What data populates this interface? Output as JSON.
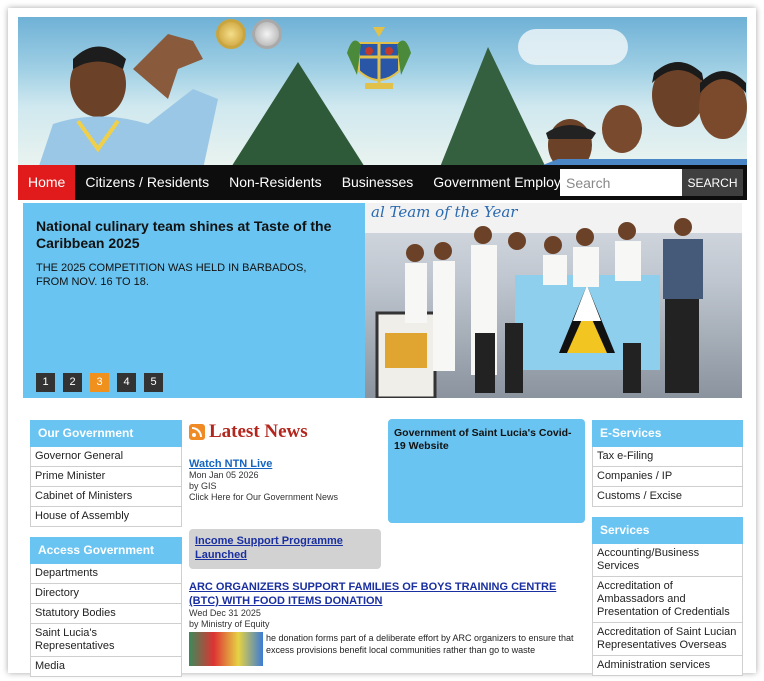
{
  "nav": {
    "items": [
      "Home",
      "Citizens / Residents",
      "Non-Residents",
      "Businesses",
      "Government Employees"
    ],
    "search_placeholder": "Search",
    "search_button": "SEARCH"
  },
  "slider": {
    "headline": "National culinary team shines at Taste of the Caribbean 2025",
    "sub": "THE 2025 COMPETITION WAS HELD IN BARBADOS, FROM NOV. 16 TO 18.",
    "pages": [
      "1",
      "2",
      "3",
      "4",
      "5"
    ],
    "active_page": "3",
    "photo_banner_text": "al Team of the Year"
  },
  "our_government": {
    "title": "Our Government",
    "items": [
      "Governor General",
      "Prime Minister",
      "Cabinet of Ministers",
      "House of Assembly"
    ]
  },
  "access_government": {
    "title": "Access Government",
    "items": [
      "Departments",
      "Directory",
      "Statutory Bodies",
      "Saint Lucia's Representatives",
      "Media"
    ]
  },
  "latest_news": {
    "title": "Latest News",
    "item1": {
      "link": "Watch NTN Live",
      "date": "Mon Jan 05 2026",
      "by": "by GIS",
      "desc": "Click Here for Our Government News"
    },
    "callout_link": "Income Support Programme Launched",
    "item2": {
      "headline": "ARC ORGANIZERS SUPPORT FAMILIES OF BOYS TRAINING CENTRE (BTC) WITH FOOD ITEMS DONATION",
      "date": "Wed Dec 31 2025",
      "by": "by Ministry of Equity",
      "excerpt": "he donation forms part of a deliberate effort by ARC organizers to ensure that excess provisions benefit local communities rather than go to waste"
    }
  },
  "covid": {
    "title": "Government of Saint Lucia's Covid-19 Website"
  },
  "eservices": {
    "title": "E-Services",
    "items": [
      "Tax e-Filing",
      "Companies / IP",
      "Customs / Excise"
    ]
  },
  "services": {
    "title": "Services",
    "items": [
      "Accounting/Business Services",
      "Accreditation of Ambassadors and Presentation of Credentials",
      "Accreditation of Saint Lucian Representatives Overseas",
      "Administration services"
    ]
  }
}
